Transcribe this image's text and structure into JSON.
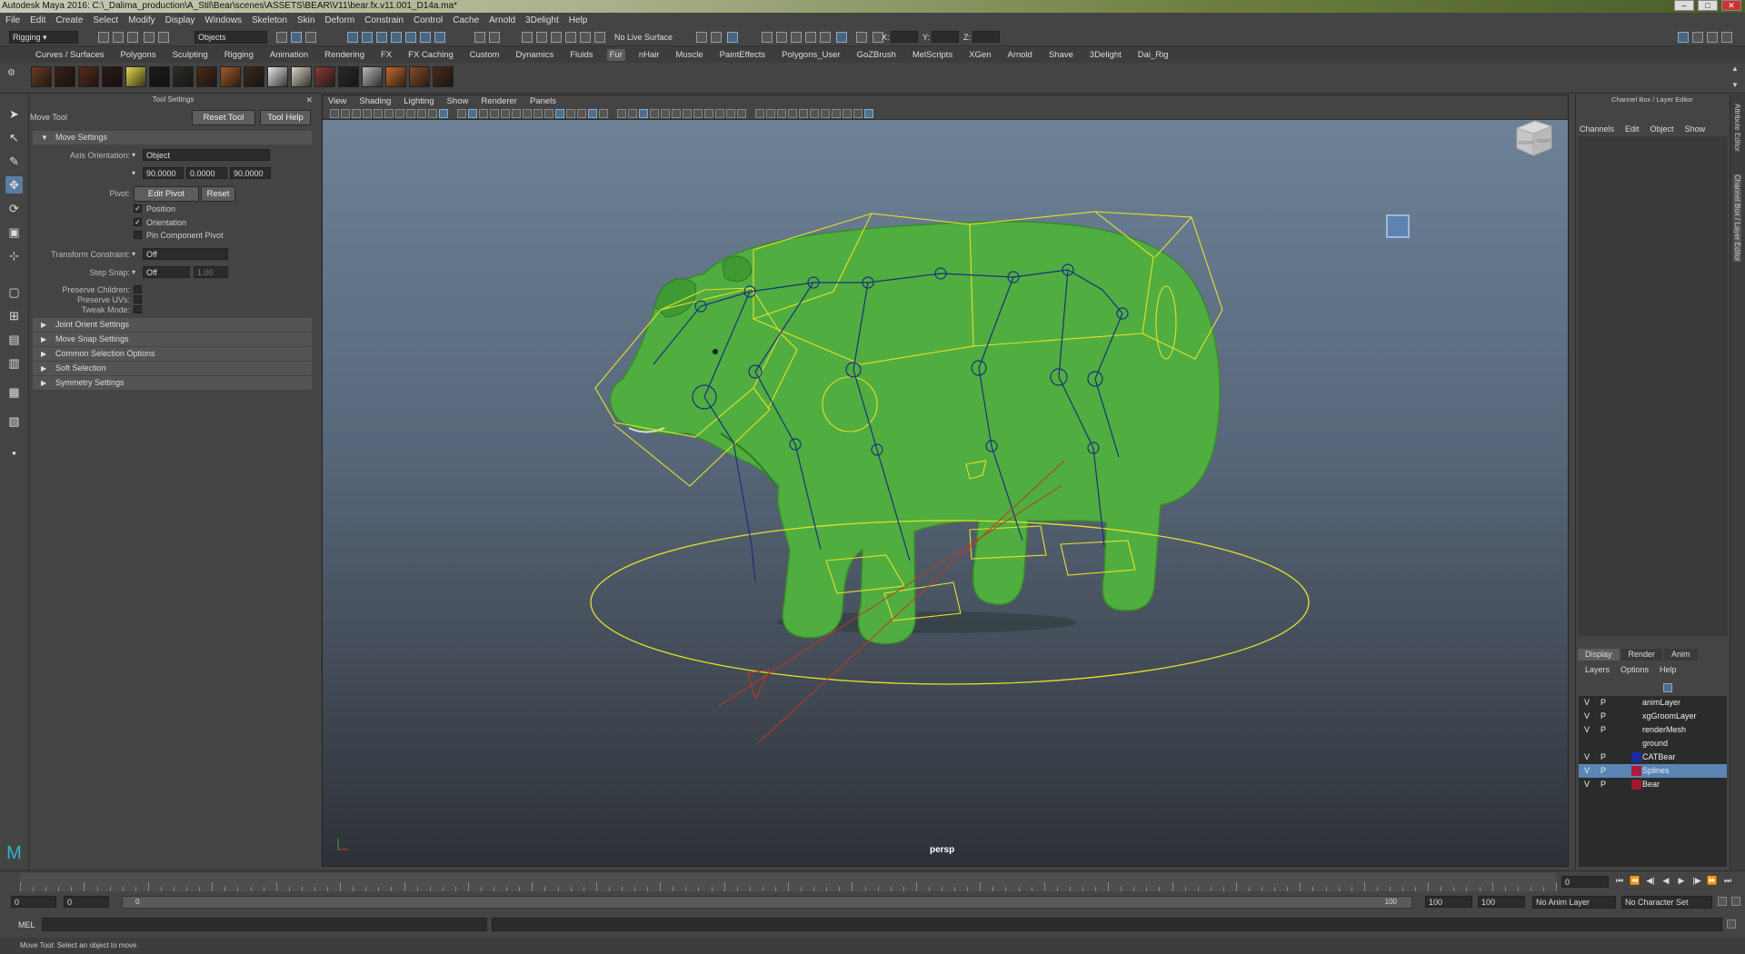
{
  "window": {
    "title": "Autodesk Maya 2016: C:\\_Dalima_production\\A_Stil\\Bear\\scenes\\ASSETS\\BEAR\\V11\\bear.fx.v11.001_D14a.ma*"
  },
  "menus": [
    "File",
    "Edit",
    "Create",
    "Select",
    "Modify",
    "Display",
    "Windows",
    "Skeleton",
    "Skin",
    "Deform",
    "Constrain",
    "Control",
    "Cache",
    "Arnold",
    "3Delight",
    "Help"
  ],
  "status": {
    "menuset": "Rigging",
    "selmode": "Objects",
    "live": "No Live Surface",
    "x": "X:",
    "y": "Y:",
    "z": "Z:"
  },
  "shelf_tabs": [
    "Curves / Surfaces",
    "Polygons",
    "Sculpting",
    "Rigging",
    "Animation",
    "Rendering",
    "FX",
    "FX Caching",
    "Custom",
    "Dynamics",
    "Fluids",
    "Fur",
    "nHair",
    "Muscle",
    "PaintEffects",
    "Polygons_User",
    "GoZBrush",
    "MelScripts",
    "XGen",
    "Arnold",
    "Shave",
    "3Delight",
    "Dai_Rig"
  ],
  "shelf_active": "Fur",
  "fur_swatches": [
    "#6b3b1e",
    "#3a2016",
    "#5a2a1a",
    "#2a1a12",
    "#e7d84a",
    "#1a1a1a",
    "#2e2e26",
    "#4b2a18",
    "#a05a2a",
    "#3a2a20",
    "#e6e6e6",
    "#d8d0c4",
    "#8a3a3a",
    "#2a2a2a",
    "#b8b8b8",
    "#c46a2a",
    "#8a4a2a",
    "#4a2a1a"
  ],
  "tool_settings": {
    "header": "Tool Settings",
    "tool_name": "Move Tool",
    "reset": "Reset Tool",
    "help": "Tool Help",
    "section_move": "Move Settings",
    "axis_label": "Axis Orientation:",
    "axis_value": "Object",
    "vals": [
      "90.0000",
      "0.0000",
      "90.0000"
    ],
    "pivot_label": "Pivot:",
    "edit_pivot": "Edit Pivot",
    "pivot_reset": "Reset",
    "position": "Position",
    "orientation": "Orientation",
    "pin": "Pin Component Pivot",
    "tc_label": "Transform Constraint:",
    "tc_value": "Off",
    "snap_label": "Step Snap:",
    "snap_value": "Off",
    "snap_num": "1.00",
    "pres_children": "Preserve Children:",
    "pres_uvs": "Preserve UVs:",
    "tweak": "Tweak Mode:",
    "sections": [
      "Joint Orient Settings",
      "Move Snap Settings",
      "Common Selection Options",
      "Soft Selection",
      "Symmetry Settings"
    ]
  },
  "viewport": {
    "menu": [
      "View",
      "Shading",
      "Lighting",
      "Show",
      "Renderer",
      "Panels"
    ],
    "camera": "persp",
    "cube_front": "FRONT",
    "cube_right": "RIGHT"
  },
  "channel_box": {
    "header": "Channel Box / Layer Editor",
    "menu": [
      "Channels",
      "Edit",
      "Object",
      "Show"
    ],
    "tabs": [
      "Display",
      "Render",
      "Anim"
    ],
    "layer_menu": [
      "Layers",
      "Options",
      "Help"
    ],
    "layers": [
      {
        "v": "V",
        "p": "P",
        "name": "animLayer",
        "color": ""
      },
      {
        "v": "V",
        "p": "P",
        "name": "xgGroomLayer",
        "color": ""
      },
      {
        "v": "V",
        "p": "P",
        "name": "renderMesh",
        "color": ""
      },
      {
        "v": "",
        "p": "",
        "name": "ground",
        "color": ""
      },
      {
        "v": "V",
        "p": "P",
        "name": "CATBear",
        "color": "#1a2aa0"
      },
      {
        "v": "V",
        "p": "P",
        "name": "Splines",
        "color": "#b01a3a"
      },
      {
        "v": "V",
        "p": "P",
        "name": "Bear",
        "color": "#a01a2a"
      }
    ],
    "side_attr": "Attribute Editor",
    "side_cb": "Channel Box / Layer Editor"
  },
  "timeline": {
    "current": "0",
    "start": "0",
    "range_start": "0",
    "range_inner": "0",
    "range_end_inner": "100",
    "range_end": "100",
    "end": "100",
    "anim_layer": "No Anim Layer",
    "char_set": "No Character Set"
  },
  "mel": {
    "label": "MEL"
  },
  "help_line": "Move Tool: Select an object to move."
}
